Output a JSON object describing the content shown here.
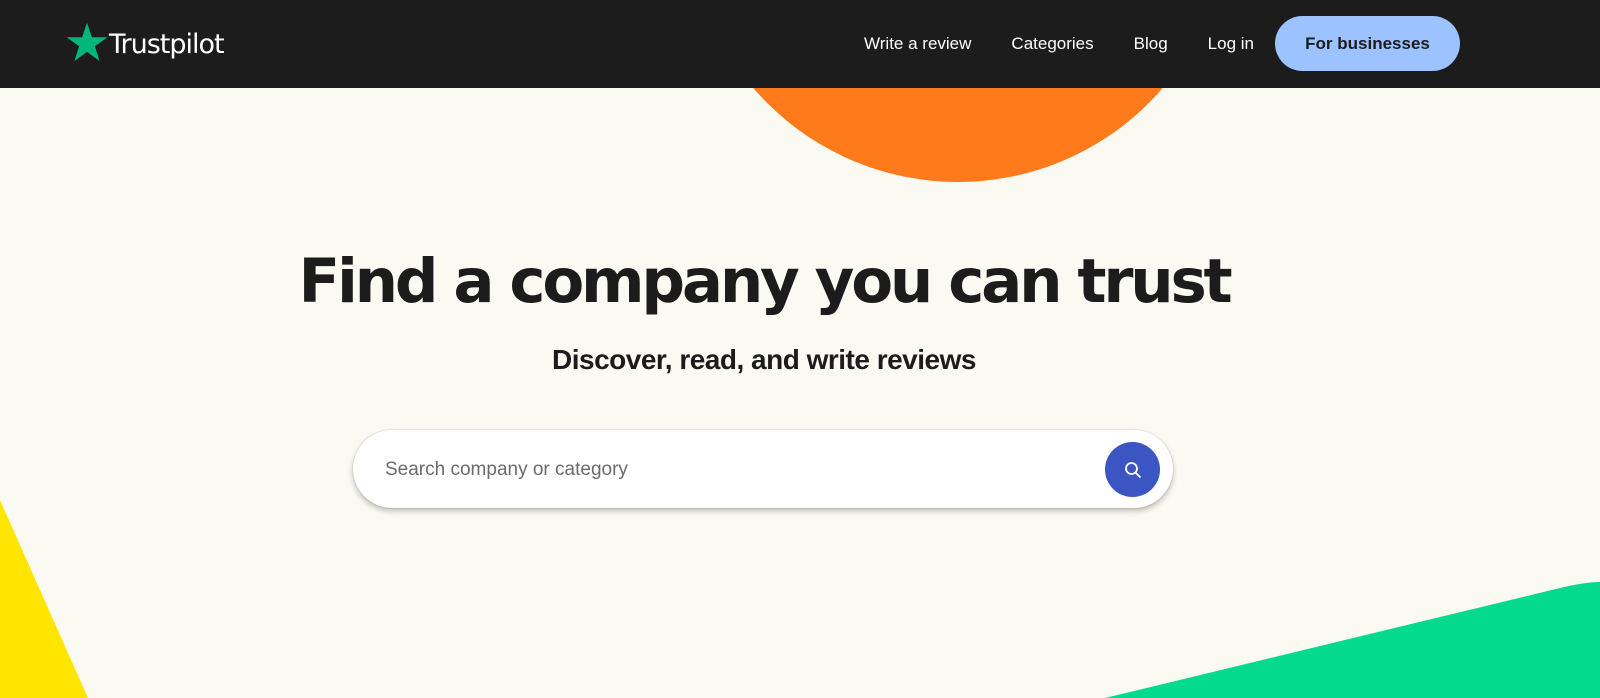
{
  "header": {
    "logo_text": "Trustpilot",
    "nav": {
      "write_review": "Write a review",
      "categories": "Categories",
      "blog": "Blog",
      "login": "Log in",
      "for_businesses": "For businesses"
    }
  },
  "hero": {
    "title": "Find a company you can trust",
    "subtitle": "Discover, read, and write reviews",
    "search": {
      "placeholder": "Search company or category",
      "value": ""
    }
  },
  "icons": {
    "logo": "star-icon",
    "search_button": "search-icon"
  },
  "colors": {
    "header_bg": "#1c1c1c",
    "page_bg": "#fbfaf2",
    "brand_star": "#00b67a",
    "business_button": "#9cc3ff",
    "search_button": "#3b55c2",
    "deco_orange": "#ff7a1a",
    "deco_yellow": "#ffe500",
    "deco_green": "#04da8d"
  }
}
